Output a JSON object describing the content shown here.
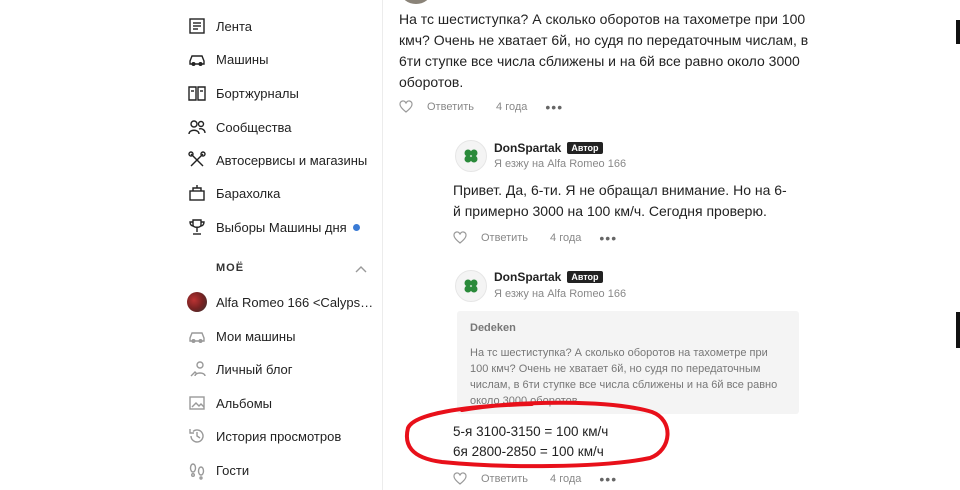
{
  "nav": {
    "items": [
      {
        "label": "Лента",
        "icon": "feed-icon"
      },
      {
        "label": "Машины",
        "icon": "car-icon"
      },
      {
        "label": "Бортжурналы",
        "icon": "logbook-icon"
      },
      {
        "label": "Сообщества",
        "icon": "community-icon"
      },
      {
        "label": "Автосервисы и магазины",
        "icon": "tools-icon"
      },
      {
        "label": "Барахолка",
        "icon": "market-icon"
      },
      {
        "label": "Выборы Машины дня",
        "icon": "trophy-icon"
      }
    ],
    "my_section_title": "МОЁ",
    "my_items": [
      {
        "label": "Alfa Romeo 166 <Calyps…",
        "icon": "car-avatar"
      },
      {
        "label": "Мои машины",
        "icon": "my-cars-icon"
      },
      {
        "label": "Личный блог",
        "icon": "blog-icon"
      },
      {
        "label": "Альбомы",
        "icon": "albums-icon"
      },
      {
        "label": "История просмотров",
        "icon": "history-icon"
      },
      {
        "label": "Гости",
        "icon": "footprints-icon"
      }
    ]
  },
  "comments": {
    "first": {
      "text": "На тс шестиступка? А сколько оборотов на тахометре при 100 кмч? Очень не хватает 6й, но судя по передаточным числам, в 6ти ступке все числа сближены и на 6й все равно около 3000 оборотов.",
      "reply": "Ответить",
      "time": "4 года",
      "more": "•••"
    },
    "reply1": {
      "author": "DonSpartak",
      "badge": "Автор",
      "car": "Я езжу на Alfa Romeo 166",
      "text": "Привет. Да, 6-ти. Я не обращал внимание. Но на 6-й примерно 3000 на 100 км/ч. Сегодня проверю.",
      "reply": "Ответить",
      "time": "4 года",
      "more": "•••"
    },
    "reply2": {
      "author": "DonSpartak",
      "badge": "Автор",
      "car": "Я езжу на Alfa Romeo 166",
      "quote_author": "Dedeken",
      "quote_text": "На тс шестиступка? А сколько оборотов на тахометре при 100 кмч? Очень не хватает 6й, но судя по передаточным числам, в 6ти ступке все числа сближены и на 6й все равно около 3000 оборотов.",
      "line1": "5-я 3100-3150 = 100 км/ч",
      "line2": "6я 2800-2850 = 100 км/ч",
      "reply": "Ответить",
      "time": "4 года",
      "more": "•••"
    }
  },
  "colors": {
    "annotation": "#e8101a",
    "badge_bg": "#222222",
    "notify_dot": "#3a7bd5"
  }
}
